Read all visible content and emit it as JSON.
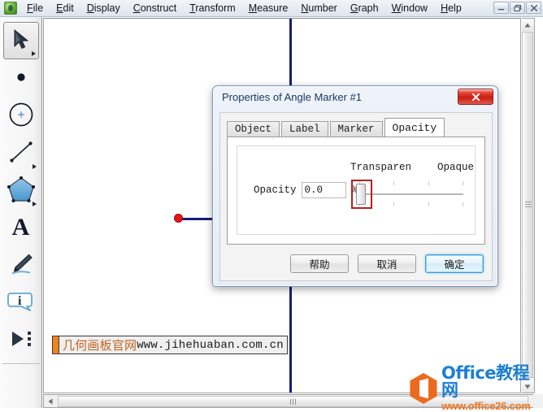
{
  "app": {
    "icon": "sketchpad-app-icon",
    "menus": [
      {
        "label": "File",
        "accel": "F"
      },
      {
        "label": "Edit",
        "accel": "E"
      },
      {
        "label": "Display",
        "accel": "D"
      },
      {
        "label": "Construct",
        "accel": "C"
      },
      {
        "label": "Transform",
        "accel": "T"
      },
      {
        "label": "Measure",
        "accel": "M"
      },
      {
        "label": "Number",
        "accel": "N"
      },
      {
        "label": "Graph",
        "accel": "G"
      },
      {
        "label": "Window",
        "accel": "W"
      },
      {
        "label": "Help",
        "accel": "H"
      }
    ],
    "window_controls": [
      {
        "name": "minimize-button",
        "glyph": "–"
      },
      {
        "name": "restore-button",
        "glyph": "❐"
      },
      {
        "name": "close-button",
        "glyph": "✕"
      }
    ]
  },
  "toolbox": {
    "tools": [
      {
        "name": "arrow-select-tool",
        "icon": "arrow-cursor-icon",
        "selected": true,
        "has_flyout": true
      },
      {
        "name": "point-tool",
        "icon": "point-icon",
        "selected": false,
        "has_flyout": false
      },
      {
        "name": "compass-circle-tool",
        "icon": "circle-compass-icon",
        "selected": false,
        "has_flyout": false
      },
      {
        "name": "straightedge-tool",
        "icon": "line-segment-icon",
        "selected": false,
        "has_flyout": true
      },
      {
        "name": "polygon-tool",
        "icon": "polygon-icon",
        "selected": false,
        "has_flyout": true
      },
      {
        "name": "text-tool",
        "icon": "text-a-icon",
        "selected": false,
        "has_flyout": false
      },
      {
        "name": "marker-tool",
        "icon": "marker-pen-icon",
        "selected": false,
        "has_flyout": false
      },
      {
        "name": "information-tool",
        "icon": "info-bubble-icon",
        "selected": false,
        "has_flyout": false
      },
      {
        "name": "custom-tools",
        "icon": "play-triangle-icon",
        "selected": false,
        "has_flyout": false
      }
    ]
  },
  "canvas": {
    "objects": [
      {
        "name": "vertical-line",
        "type": "line",
        "color": "#1b1b7a"
      },
      {
        "name": "horizontal-ray",
        "type": "ray",
        "color": "#1b1b7a"
      },
      {
        "name": "endpoint-marker",
        "type": "point",
        "color": "#e81414"
      }
    ],
    "text_object": {
      "chinese": "几何画板官网",
      "url": "www.jihehuaban.com.cn",
      "chinese_color": "#c2641e",
      "url_color": "#1a1a1a",
      "handle_color": "#f08419"
    }
  },
  "dialog": {
    "title": "Properties of Angle Marker #1",
    "close_glyph": "✕",
    "tabs": [
      {
        "label": "Object",
        "active": false
      },
      {
        "label": "Label",
        "active": false
      },
      {
        "label": "Marker",
        "active": false
      },
      {
        "label": "Opacity",
        "active": true
      }
    ],
    "opacity_panel": {
      "transparent_label": "Transparen",
      "opaque_label": "Opaque",
      "field_label": "Opacity",
      "value": "0.0",
      "placeholder": "0.0",
      "percent_sign": "%",
      "slider": {
        "name": "opacity-slider",
        "min": 0,
        "max": 100,
        "value": 0,
        "highlight_color": "#b32020"
      }
    },
    "buttons": [
      {
        "name": "help-button",
        "label": "帮助",
        "default": false
      },
      {
        "name": "cancel-button",
        "label": "取消",
        "default": false
      },
      {
        "name": "ok-button",
        "label": "确定",
        "default": true
      }
    ]
  },
  "watermark": {
    "title": "Office教程网",
    "url": "www.office26.com",
    "title_color": "#1a7fd4",
    "url_color": "#ef7521",
    "logo": "office-hex-logo-icon"
  },
  "scrollbars": {
    "vertical": {
      "name": "vertical-scrollbar",
      "up_glyph": "▲",
      "down_glyph": "▼"
    },
    "horizontal": {
      "name": "horizontal-scrollbar",
      "left_glyph": "◀",
      "right_glyph": "▶"
    }
  }
}
